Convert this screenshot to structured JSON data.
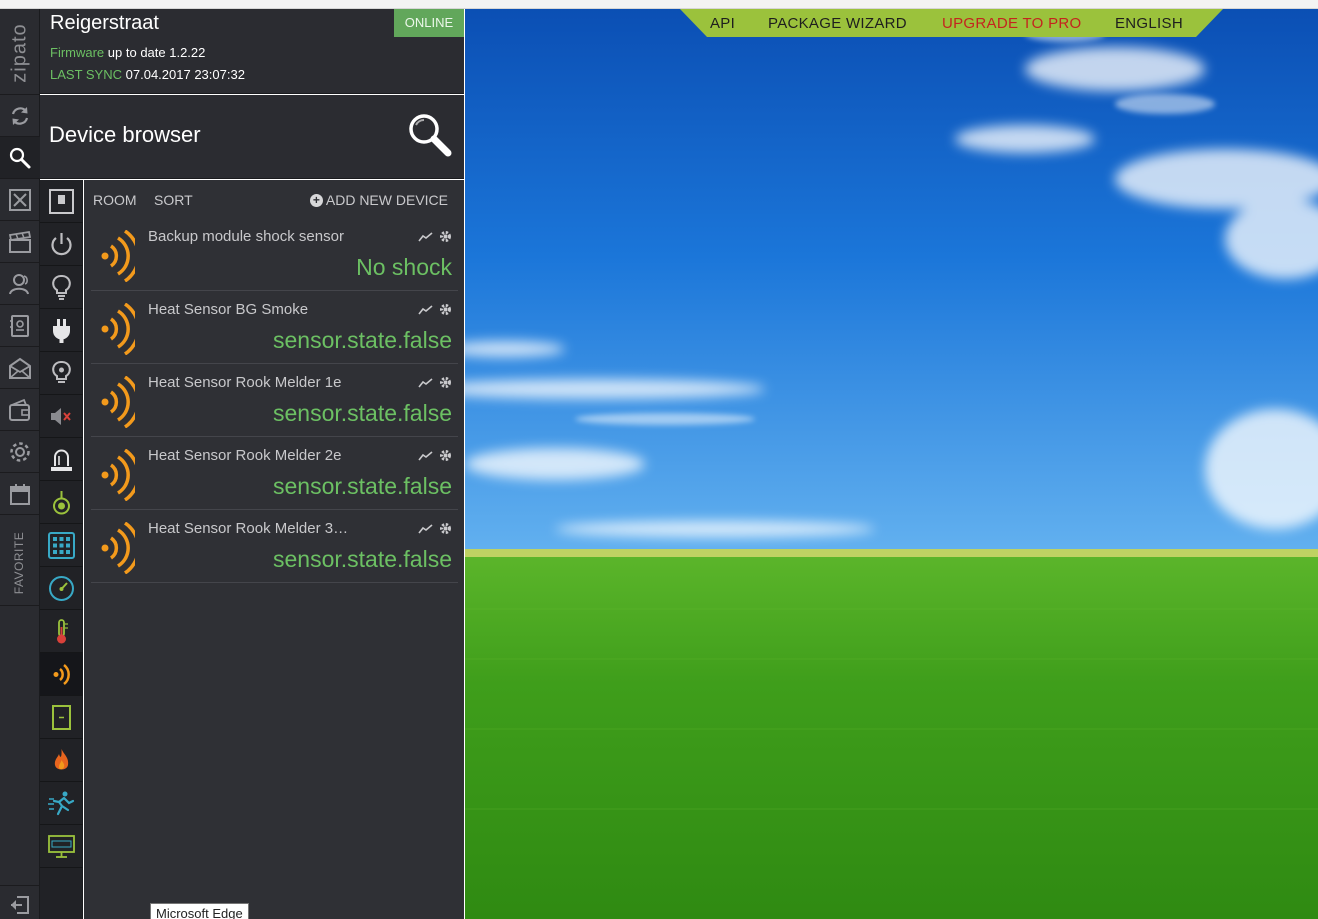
{
  "brand": {
    "logo_text": "zipato"
  },
  "header": {
    "location": "Reigerstraat",
    "status": "ONLINE",
    "firmware_label": "Firmware",
    "firmware_text": "up to date 1.2.22",
    "sync_label": "LAST SYNC",
    "sync_value": "07.04.2017 23:07:32"
  },
  "page": {
    "title": "Device browser"
  },
  "sidebar": {
    "favorite_label": "FAVORITE",
    "icons": [
      "sync-icon",
      "search-icon",
      "grid-icon",
      "scenes-icon",
      "users-icon",
      "contacts-icon",
      "messages-icon",
      "wallet-icon",
      "settings-icon",
      "calendar-icon"
    ]
  },
  "toolbar": {
    "room_label": "ROOM",
    "sort_label": "SORT",
    "add_label": "ADD NEW DEVICE"
  },
  "devices": [
    {
      "name": "Backup module shock sensor",
      "state": "No shock"
    },
    {
      "name": "Heat Sensor BG Smoke",
      "state": "sensor.state.false"
    },
    {
      "name": "Heat Sensor Rook Melder 1e",
      "state": "sensor.state.false"
    },
    {
      "name": "Heat Sensor Rook Melder 2e",
      "state": "sensor.state.false"
    },
    {
      "name": "Heat Sensor Rook Melder 3…",
      "state": "sensor.state.false"
    }
  ],
  "topnav": {
    "api": "API",
    "wizard": "PACKAGE WIZARD",
    "pro": "UPGRADE TO PRO",
    "lang": "ENGLISH"
  },
  "tooltip": {
    "text": "Microsoft Edge"
  },
  "colors": {
    "accent_green": "#6cc063",
    "online_badge": "#62a75b",
    "sensor_orange": "#f39a1c",
    "nav_bar": "#9bc23c",
    "upgrade_red": "#c4241e"
  }
}
